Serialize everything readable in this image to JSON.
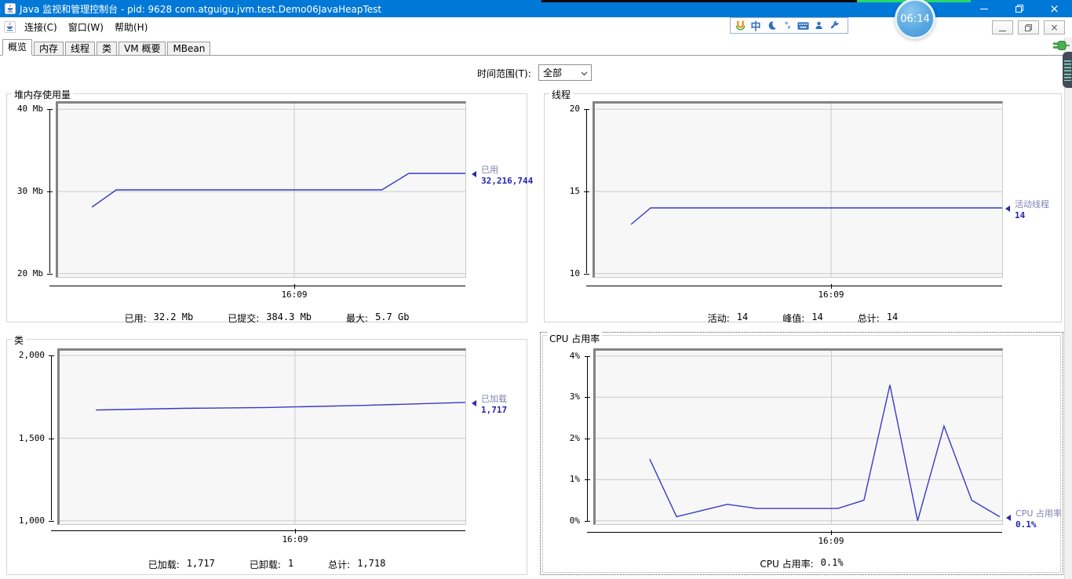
{
  "colors": {
    "titlebar": "#0078d7",
    "line": "#3939c8",
    "grid": "#cbcbcb",
    "plot_bg": "#f7f7f7",
    "series_name": "#8080b0",
    "series_value": "#2323b0",
    "plug_green": "#3fae49"
  },
  "os_window": {
    "title": "Java 监视和管理控制台 - pid: 9628 com.atguigu.jvm.test.Demo06JavaHeapTest",
    "clock_overlay": "06:14"
  },
  "menu_bar": {
    "items": [
      "连接(C)",
      "窗口(W)",
      "帮助(H)"
    ]
  },
  "ime_toolbar": {
    "mode_char": "中",
    "punctuation_text": "°,",
    "icons": [
      "sogou-logo",
      "chinese-mode",
      "moon",
      "punctuation",
      "keyboard",
      "user",
      "wrench"
    ]
  },
  "tab_bar": {
    "tabs": [
      "概览",
      "内存",
      "线程",
      "类",
      "VM 概要",
      "MBean"
    ],
    "active": "概览"
  },
  "controls": {
    "time_range_label": "时间范围(T):",
    "time_range_value": "全部"
  },
  "chart_data": [
    {
      "type": "line",
      "title": "堆内存使用量",
      "ylim": [
        19.6,
        40.7
      ],
      "yticks": [
        {
          "v": 40,
          "label": "40 Mb"
        },
        {
          "v": 30,
          "label": "30 Mb"
        },
        {
          "v": 20,
          "label": "20 Mb"
        }
      ],
      "x_tick": {
        "pos": 0.58,
        "label": "16:09"
      },
      "series": [
        {
          "name": "已用",
          "end_value": "32,216,744",
          "points": [
            [
              0.083,
              28.1
            ],
            [
              0.143,
              30.2
            ],
            [
              0.795,
              30.2
            ],
            [
              0.861,
              32.2
            ],
            [
              1.0,
              32.2
            ]
          ]
        }
      ],
      "stats": [
        {
          "label": "已用:",
          "value": "32.2 Mb"
        },
        {
          "label": "已提交:",
          "value": "384.3 Mb"
        },
        {
          "label": "最大:",
          "value": "5.7 Gb"
        }
      ]
    },
    {
      "type": "line",
      "title": "线程",
      "ylim": [
        9.8,
        20.35
      ],
      "yticks": [
        {
          "v": 20,
          "label": "20"
        },
        {
          "v": 15,
          "label": "15"
        },
        {
          "v": 10,
          "label": "10"
        }
      ],
      "x_tick": {
        "pos": 0.58,
        "label": "16:09"
      },
      "series": [
        {
          "name": "活动线程",
          "end_value": "14",
          "points": [
            [
              0.089,
              13.0
            ],
            [
              0.137,
              14.0
            ],
            [
              1.0,
              14.0
            ]
          ]
        }
      ],
      "stats": [
        {
          "label": "活动:",
          "value": "14"
        },
        {
          "label": "峰值:",
          "value": "14"
        },
        {
          "label": "总计:",
          "value": "14"
        }
      ]
    },
    {
      "type": "line",
      "title": "类",
      "ylim": [
        980,
        2030
      ],
      "yticks": [
        {
          "v": 2000,
          "label": "2,000"
        },
        {
          "v": 1500,
          "label": "1,500"
        },
        {
          "v": 1000,
          "label": "1,000"
        }
      ],
      "x_tick": {
        "pos": 0.58,
        "label": "16:09"
      },
      "series": [
        {
          "name": "已加载",
          "end_value": "1,717",
          "points": [
            [
              0.089,
              1671
            ],
            [
              0.3,
              1681
            ],
            [
              0.51,
              1686
            ],
            [
              0.75,
              1699
            ],
            [
              1.0,
              1717
            ]
          ]
        }
      ],
      "stats": [
        {
          "label": "已加载:",
          "value": "1,717"
        },
        {
          "label": "已卸载:",
          "value": "1"
        },
        {
          "label": "总计:",
          "value": "1,718"
        }
      ]
    },
    {
      "type": "line",
      "title": "CPU 占用率",
      "ylim": [
        -0.08,
        4.13
      ],
      "yticks": [
        {
          "v": 4,
          "label": "4%"
        },
        {
          "v": 3,
          "label": "3%"
        },
        {
          "v": 2,
          "label": "2%"
        },
        {
          "v": 1,
          "label": "1%"
        },
        {
          "v": 0,
          "label": "0%"
        }
      ],
      "x_tick": {
        "pos": 0.58,
        "label": "16:09"
      },
      "series": [
        {
          "name": "CPU 占用率",
          "end_value": "0.1%",
          "points": [
            [
              0.133,
              1.5
            ],
            [
              0.199,
              0.1
            ],
            [
              0.324,
              0.4
            ],
            [
              0.396,
              0.3
            ],
            [
              0.596,
              0.3
            ],
            [
              0.66,
              0.5
            ],
            [
              0.724,
              3.3
            ],
            [
              0.792,
              0.0
            ],
            [
              0.857,
              2.3
            ],
            [
              0.925,
              0.5
            ],
            [
              0.994,
              0.1
            ]
          ]
        }
      ],
      "stats": [
        {
          "label": "CPU 占用率:",
          "value": "0.1%"
        }
      ]
    }
  ]
}
